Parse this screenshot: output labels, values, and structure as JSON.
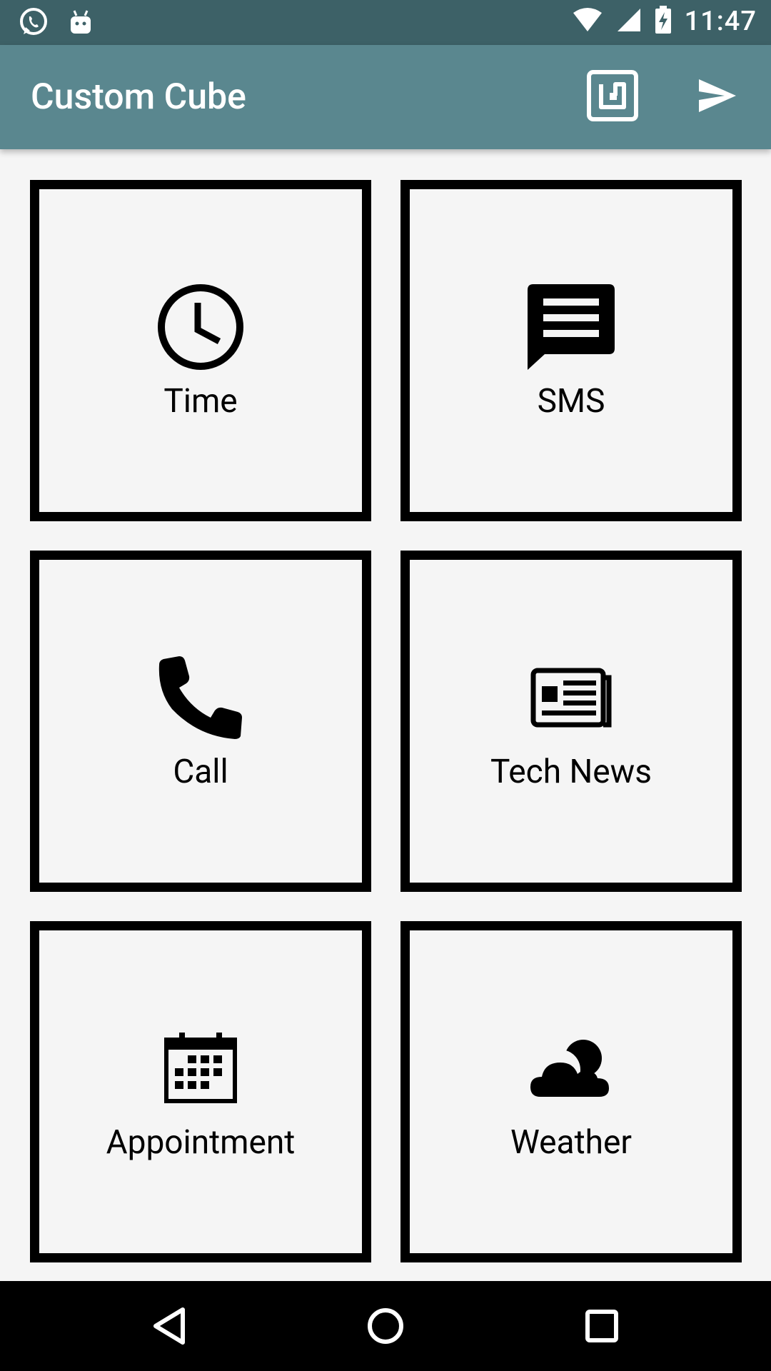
{
  "status_bar": {
    "time": "11:47",
    "left_icons": [
      "whatsapp-icon",
      "android-icon"
    ],
    "right_icons": [
      "wifi-icon",
      "signal-icon",
      "battery-charging-icon"
    ]
  },
  "app_bar": {
    "title": "Custom Cube",
    "actions": [
      "nfc-icon",
      "send-icon"
    ],
    "background": "#5a878f"
  },
  "tiles": [
    {
      "label": "Time",
      "icon": "clock-icon"
    },
    {
      "label": "SMS",
      "icon": "message-icon"
    },
    {
      "label": "Call",
      "icon": "phone-icon"
    },
    {
      "label": "Tech News",
      "icon": "newspaper-icon"
    },
    {
      "label": "Appointment",
      "icon": "calendar-icon"
    },
    {
      "label": "Weather",
      "icon": "weather-icon"
    }
  ],
  "nav_bar": {
    "buttons": [
      "back-icon",
      "home-icon",
      "recents-icon"
    ]
  }
}
